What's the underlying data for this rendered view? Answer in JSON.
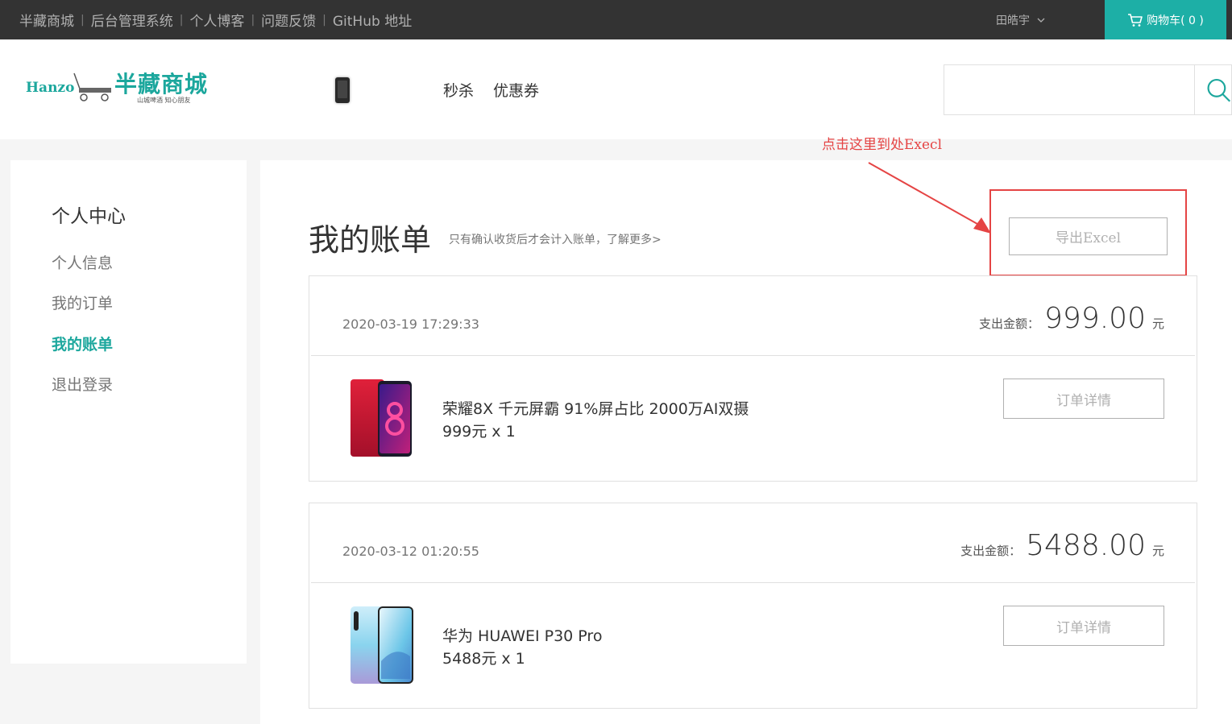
{
  "topnav": {
    "links": [
      "半藏商城",
      "后台管理系统",
      "个人博客",
      "问题反馈",
      "GitHub 地址"
    ],
    "user": "田皓宇",
    "cart_label": "购物车( 0 )"
  },
  "header": {
    "logo": {
      "hanzo": "Hanzo",
      "name": "半藏商城",
      "slogan": "山城啤酒 知心朋友"
    },
    "nav": [
      "秒杀",
      "优惠券"
    ],
    "search_value": ""
  },
  "sidebar": {
    "heading": "个人中心",
    "items": [
      {
        "label": "个人信息",
        "active": false
      },
      {
        "label": "我的订单",
        "active": false
      },
      {
        "label": "我的账单",
        "active": true
      },
      {
        "label": "退出登录",
        "active": false
      }
    ]
  },
  "main": {
    "title": "我的账单",
    "subtitle": "只有确认收货后才会计入账单，了解更多>",
    "export_label": "导出Excel",
    "annotation": "点击这里到处Execl",
    "bills": [
      {
        "date": "2020-03-19 17:29:33",
        "amount_label": "支出金额：",
        "amount": "999.00",
        "unit": "元",
        "product": "荣耀8X 千元屏霸 91%屏占比 2000万AI双摄",
        "qty": "999元 x 1",
        "detail_label": "订单详情"
      },
      {
        "date": "2020-03-12 01:20:55",
        "amount_label": "支出金额：",
        "amount": "5488.00",
        "unit": "元",
        "product": "华为 HUAWEI P30 Pro",
        "qty": "5488元 x 1",
        "detail_label": "订单详情"
      }
    ]
  },
  "colors": {
    "accent": "#1dafa6",
    "topbar": "#333333",
    "annotation": "#e54444"
  }
}
